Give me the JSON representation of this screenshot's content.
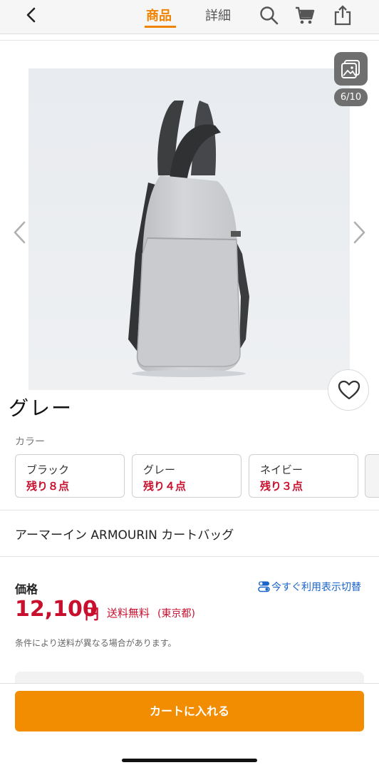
{
  "header": {
    "tabs": [
      {
        "label": "商品",
        "active": true
      },
      {
        "label": "詳細",
        "active": false
      }
    ],
    "icons": [
      "back-chevron-icon",
      "search-icon",
      "cart-icon",
      "share-icon"
    ]
  },
  "gallery": {
    "counter": "6/10",
    "current": 6,
    "total": 10
  },
  "selected_color": "グレー",
  "color_section": {
    "label": "カラー",
    "variants": [
      {
        "name": "ブラック",
        "stock": "残り８点"
      },
      {
        "name": "グレー",
        "stock": "残り４点"
      },
      {
        "name": "ネイビー",
        "stock": "残り３点"
      }
    ]
  },
  "product": {
    "name": "アーマーイン ARMOURIN カートバッグ"
  },
  "price": {
    "label": "価格",
    "amount": "12,100",
    "currency": "円",
    "shipping": "送料無料",
    "shipping_region": "(東京都)",
    "toggle_label": "今すぐ利用表示切替",
    "note": "条件により送料が異なる場合があります。"
  },
  "cart_button": {
    "label": "カートに入れる"
  },
  "colors": {
    "accent": "#f28c00",
    "price": "#c8102e",
    "link": "#1a63c8"
  }
}
